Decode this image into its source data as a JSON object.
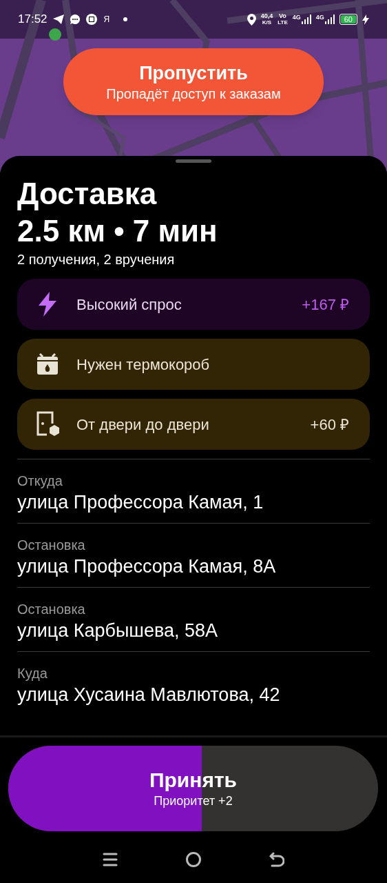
{
  "status_bar": {
    "time": "17:52",
    "app_glyph": "Я",
    "speed": "40,4",
    "speed_unit": "K/S",
    "volte_top": "Vo",
    "volte_bottom": "LTE",
    "network_1": "4G",
    "network_2": "4G",
    "battery": "60"
  },
  "skip_button": {
    "title": "Пропустить",
    "subtitle": "Пропадёт доступ к заказам"
  },
  "order": {
    "title": "Доставка",
    "summary": "2.5 км • 7 мин",
    "details": "2 получения, 2 вручения"
  },
  "features": [
    {
      "kind": "demand",
      "label": "Высокий спрос",
      "amount": "+167 ₽"
    },
    {
      "kind": "thermobox",
      "label": "Нужен термокороб"
    },
    {
      "kind": "door",
      "label": "От двери до двери",
      "amount": "+60 ₽"
    }
  ],
  "route": [
    {
      "label": "Откуда",
      "address": "улица Профессора Камая, 1"
    },
    {
      "label": "Остановка",
      "address": "улица Профессора Камая, 8А"
    },
    {
      "label": "Остановка",
      "address": "улица Карбышева, 58А"
    },
    {
      "label": "Куда",
      "address": "улица Хусаина Мавлютова, 42"
    }
  ],
  "accept_button": {
    "title": "Принять",
    "subtitle": "Приоритет +2",
    "level": 0.523
  }
}
